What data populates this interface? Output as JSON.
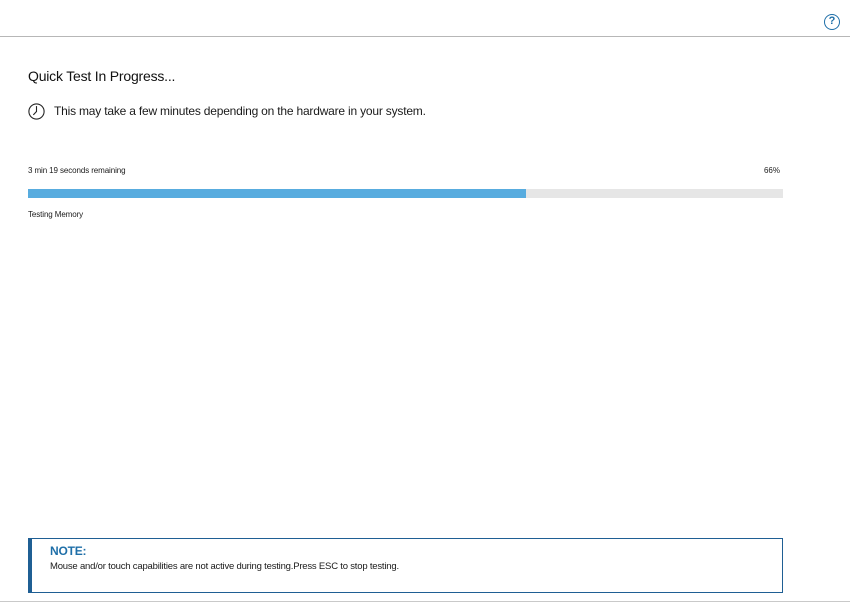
{
  "header": {
    "help_icon": "question-circle-icon",
    "help_glyph": "?"
  },
  "main": {
    "title": "Quick Test In Progress...",
    "subtitle_icon": "clock-icon",
    "subtitle": "This may take a few minutes depending on the hardware in your system."
  },
  "progress": {
    "time_remaining": "3 min 19 seconds remaining",
    "percent_label": "66%",
    "percent_value": 66,
    "current_test": "Testing Memory",
    "fill_color": "#58acdf",
    "track_color": "#e6e6e6"
  },
  "note": {
    "title": "NOTE:",
    "text": "Mouse and/or touch capabilities are not active during testing.Press ESC to stop testing.",
    "accent_color": "#1f5f94"
  }
}
